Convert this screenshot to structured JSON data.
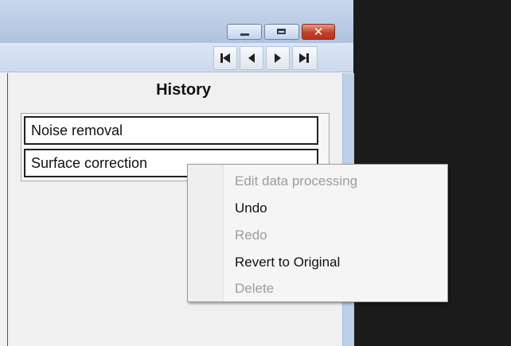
{
  "window": {
    "controls": {
      "minimize": "minimize-icon",
      "maximize": "maximize-icon",
      "close": "close-icon",
      "close_color": "#c0412a"
    }
  },
  "toolbar": {
    "icons": [
      "skip-first-icon",
      "previous-icon",
      "next-icon",
      "skip-last-icon"
    ]
  },
  "history": {
    "title": "History",
    "items": [
      "Noise removal",
      "Surface correction"
    ]
  },
  "context_menu": {
    "items": [
      {
        "label": "Edit data processing",
        "enabled": false
      },
      {
        "label": "Undo",
        "enabled": true
      },
      {
        "label": "Redo",
        "enabled": false
      },
      {
        "label": "Revert to Original",
        "enabled": true
      },
      {
        "label": "Delete",
        "enabled": false
      }
    ]
  },
  "colors": {
    "titlebar": "#b9cbe4",
    "scrollbar": "#bcd0ea",
    "desktop": "#1b1b1b"
  }
}
